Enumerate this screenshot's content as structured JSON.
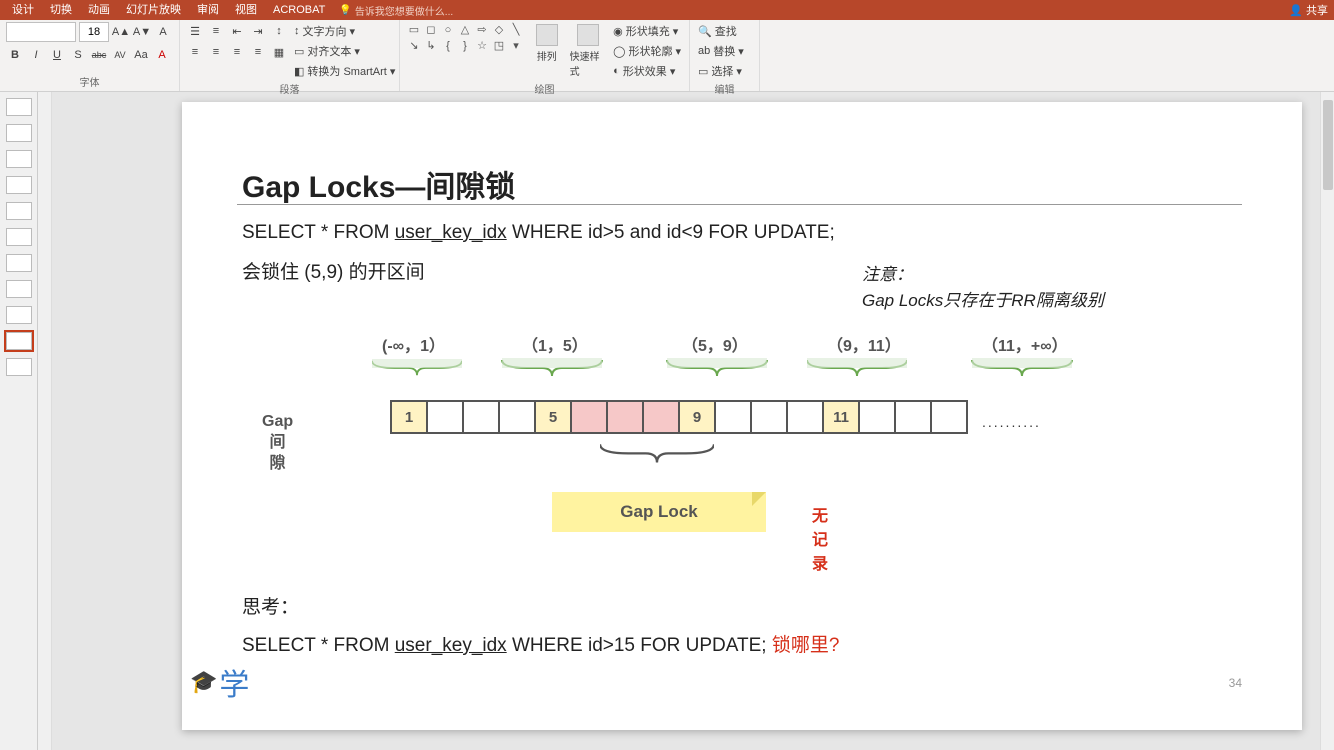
{
  "tabs": [
    "设计",
    "切换",
    "动画",
    "幻灯片放映",
    "审阅",
    "视图",
    "ACROBAT"
  ],
  "tell_me": "告诉我您想要做什么...",
  "share": "共享",
  "ribbon": {
    "font": {
      "size": "18",
      "buttons": [
        "B",
        "I",
        "U",
        "S",
        "abc",
        "AV",
        "Aa",
        "A"
      ],
      "grow": "A▲",
      "shrink": "A▼",
      "clear": "A",
      "label": "字体"
    },
    "para": {
      "textdir": "文字方向",
      "align": "对齐文本",
      "smartart": "转换为 SmartArt",
      "label": "段落"
    },
    "draw": {
      "arrange": "排列",
      "quick": "快速样式",
      "fill": "形状填充",
      "outline": "形状轮廓",
      "effects": "形状效果",
      "label": "绘图"
    },
    "edit": {
      "find": "查找",
      "replace": "替换",
      "select": "选择",
      "label": "编辑"
    }
  },
  "slide": {
    "title": "Gap Locks—间隙锁",
    "sql1_a": "SELECT * FROM ",
    "sql1_u": "user_key_idx",
    "sql1_b": " WHERE id>5 and id<9 FOR UPDATE;",
    "line2": "会锁住 (5,9) 的开区间",
    "note1": "注意：",
    "note2": "Gap Locks只存在于RR隔离级别",
    "gap_label_a": "Gap",
    "gap_label_b": "间隙",
    "intervals": [
      "(-∞，1）",
      "（1，5）",
      "（5，9）",
      "（9，11）",
      "（11，+∞）"
    ],
    "cells": [
      {
        "v": "1",
        "c": "yellow"
      },
      {
        "v": "",
        "c": ""
      },
      {
        "v": "",
        "c": ""
      },
      {
        "v": "",
        "c": ""
      },
      {
        "v": "5",
        "c": "yellow"
      },
      {
        "v": "",
        "c": "pink"
      },
      {
        "v": "",
        "c": "pink"
      },
      {
        "v": "",
        "c": "pink"
      },
      {
        "v": "9",
        "c": "yellow"
      },
      {
        "v": "",
        "c": ""
      },
      {
        "v": "",
        "c": ""
      },
      {
        "v": "",
        "c": ""
      },
      {
        "v": "11",
        "c": "yellow"
      },
      {
        "v": "",
        "c": ""
      },
      {
        "v": "",
        "c": ""
      },
      {
        "v": "",
        "c": ""
      }
    ],
    "dots": "..........",
    "gaplock": "Gap Lock",
    "norecord": "无记录",
    "think": "思考：",
    "sql2_a": "SELECT * FROM ",
    "sql2_u": "user_key_idx",
    "sql2_b": " WHERE id>15 FOR UPDATE; ",
    "sql2_q": "锁哪里?",
    "pagenum": "34",
    "logo": "学"
  }
}
